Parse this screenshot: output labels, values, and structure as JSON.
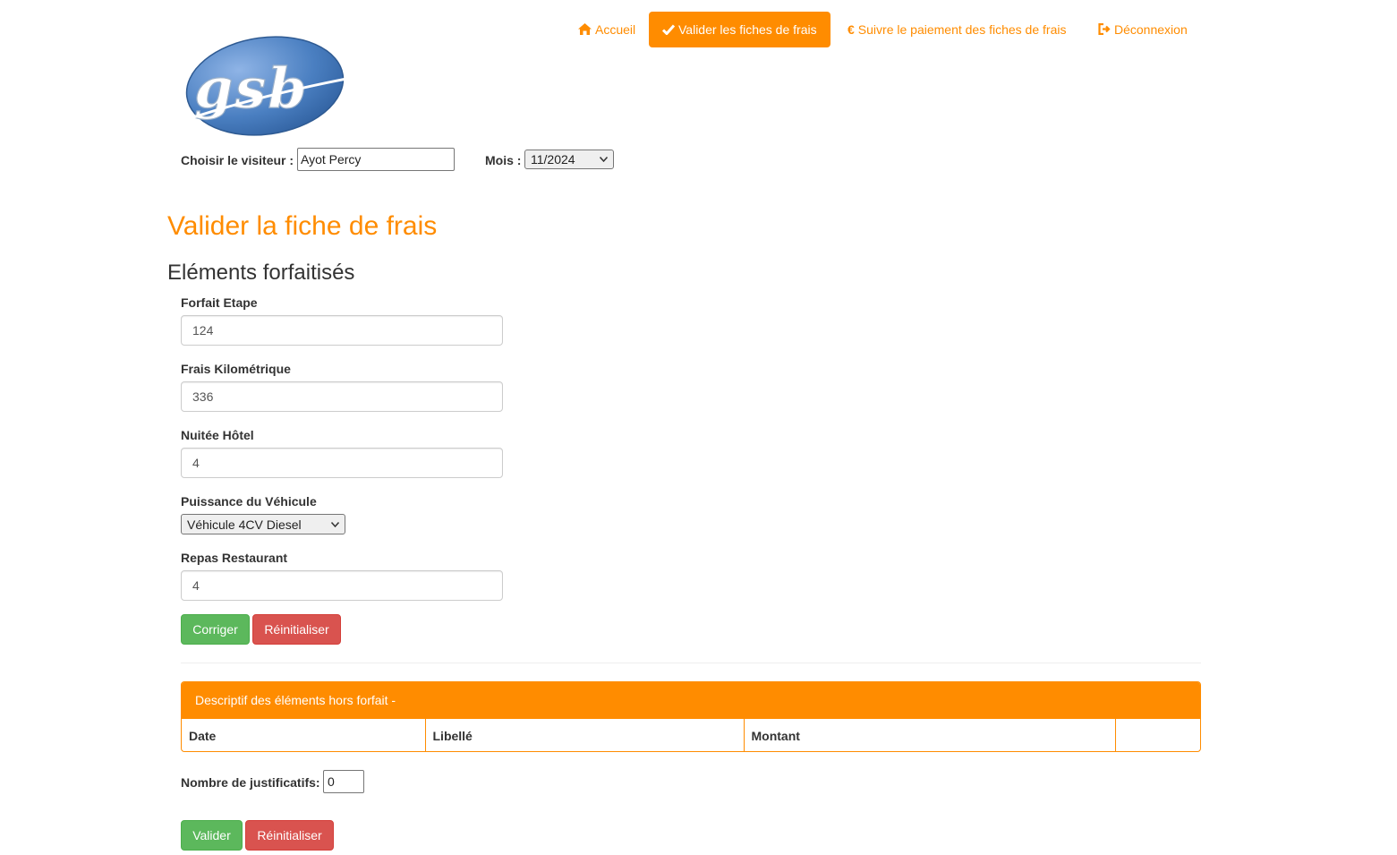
{
  "nav": {
    "accueil": "Accueil",
    "valider": "Valider les fiches de frais",
    "suivre": "Suivre le paiement des fiches de frais",
    "deconnexion": "Déconnexion"
  },
  "brand": {
    "logo_text": "gsb",
    "logo_color": "#4a7fc1"
  },
  "selector": {
    "visitor_label": "Choisir le visiteur :",
    "visitor_value": "Ayot Percy",
    "mois_label": "Mois :",
    "mois_value": "11/2024"
  },
  "page": {
    "title": "Valider la fiche de frais",
    "section_title": "Eléments forfaitisés"
  },
  "forfait": {
    "etape_label": "Forfait Etape",
    "etape_value": "124",
    "km_label": "Frais Kilométrique",
    "km_value": "336",
    "nuitee_label": "Nuitée Hôtel",
    "nuitee_value": "4",
    "vehicule_label": "Puissance du Véhicule",
    "vehicule_value": "Véhicule 4CV Diesel",
    "repas_label": "Repas Restaurant",
    "repas_value": "4",
    "corriger_button": "Corriger",
    "reinit_button": "Réinitialiser"
  },
  "horsforfait": {
    "panel_title": "Descriptif des éléments hors forfait -",
    "columns": [
      "Date",
      "Libellé",
      "Montant",
      ""
    ]
  },
  "justificatifs": {
    "label": "Nombre de justificatifs:",
    "value": "0"
  },
  "footer_buttons": {
    "valider": "Valider",
    "reinit": "Réinitialiser"
  },
  "colors": {
    "accent": "#ff8c00",
    "success": "#5cb85c",
    "danger": "#d9534f"
  }
}
